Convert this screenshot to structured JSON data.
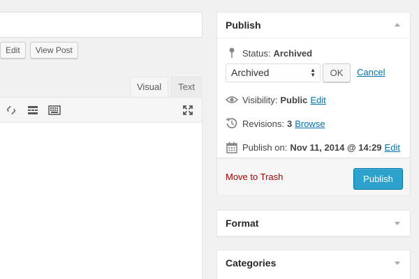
{
  "editor": {
    "permalink_buttons": {
      "edit": "Edit",
      "view_post": "View Post"
    },
    "tabs": [
      {
        "label": "Visual",
        "active": true
      },
      {
        "label": "Text",
        "active": false
      }
    ],
    "toolbar_icons": [
      "unlink-icon",
      "read-more-icon",
      "toolbar-toggle-icon",
      "fullscreen-icon"
    ]
  },
  "publish": {
    "title": "Publish",
    "status": {
      "label": "Status:",
      "value": "Archived"
    },
    "status_select": {
      "selected": "Archived"
    },
    "ok_label": "OK",
    "cancel_label": "Cancel",
    "visibility": {
      "label": "Visibility:",
      "value": "Public",
      "edit": "Edit"
    },
    "revisions": {
      "label": "Revisions:",
      "value": "3",
      "browse": "Browse"
    },
    "publish_on": {
      "label": "Publish on:",
      "value": "Nov 11, 2014 @ 14:29",
      "edit": "Edit"
    },
    "trash_label": "Move to Trash",
    "publish_button": "Publish"
  },
  "format": {
    "title": "Format"
  },
  "categories": {
    "title": "Categories"
  },
  "colors": {
    "link": "#0073aa",
    "trash": "#aa0000",
    "primary_button": "#2ea2cc"
  }
}
